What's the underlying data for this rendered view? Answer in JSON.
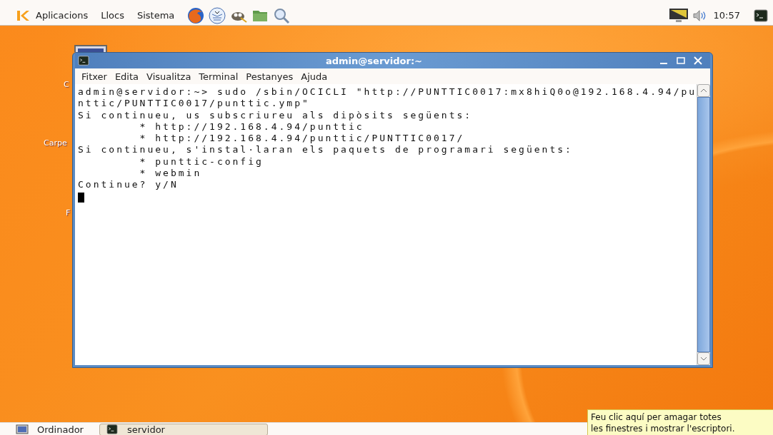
{
  "top_panel": {
    "menus": [
      "Aplicacions",
      "Llocs",
      "Sistema"
    ],
    "clock": "10:57"
  },
  "desktop_icons": [
    {
      "label": "C"
    },
    {
      "label": "Carpe"
    },
    {
      "label": "F"
    }
  ],
  "window": {
    "title": "admin@servidor:~",
    "menu": [
      "Fitxer",
      "Edita",
      "Visualitza",
      "Terminal",
      "Pestanyes",
      "Ajuda"
    ],
    "lines": [
      "admin@servidor:~> sudo /sbin/OCICLI \"http://PUNTTIC0017:mx8hiQ0o@192.168.4.94/pu",
      "nttic/PUNTTIC0017/punttic.ymp\"",
      "Si continueu, us subscriureu als dipòsits següents:",
      "        * http://192.168.4.94/punttic",
      "        * http://192.168.4.94/punttic/PUNTTIC0017/",
      "Si continueu, s'instal·laran els paquets de programari següents:",
      "        * punttic-config",
      "        * webmin",
      "Continue? y/N"
    ]
  },
  "bottom_panel": {
    "show_desktop": "Ordinador",
    "tasks": [
      {
        "label": "servidor",
        "selected": true
      }
    ]
  },
  "tooltip": {
    "lines": [
      "Feu clic aquí per amagar totes",
      "les finestres i mostrar l'escriptori."
    ]
  }
}
